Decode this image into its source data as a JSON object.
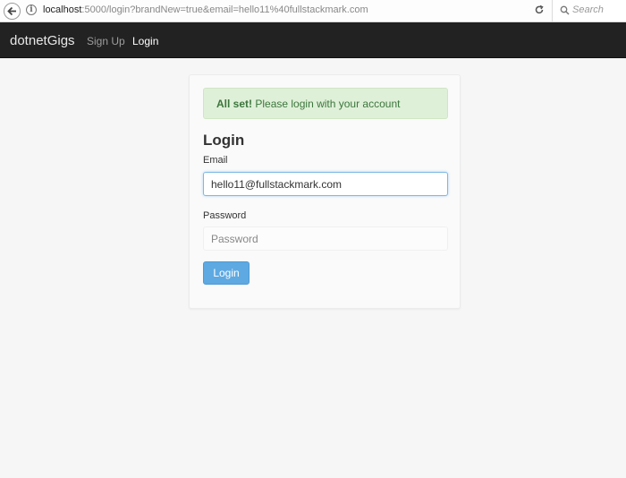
{
  "browser": {
    "url_host": "localhost",
    "url_rest": ":5000/login?brandNew=true&email=hello11%40fullstackmark.com",
    "search_placeholder": "Search",
    "icons": [
      "back-arrow-icon",
      "info-icon",
      "reload-icon",
      "search-icon"
    ]
  },
  "navbar": {
    "brand": "dotnetGigs",
    "links": [
      {
        "label": "Sign Up"
      },
      {
        "label": "Login"
      }
    ]
  },
  "alert": {
    "strong": "All set!",
    "message": "Please login with your account"
  },
  "form": {
    "title": "Login",
    "email_label": "Email",
    "email_value": "hello11@fullstackmark.com",
    "password_label": "Password",
    "password_placeholder": "Password",
    "submit_label": "Login"
  },
  "colors": {
    "navbar_bg": "#222222",
    "alert_bg": "#dff0d8",
    "alert_text": "#3c763d",
    "button_bg": "#5ea9e2",
    "focus_border": "#7cb8e6"
  }
}
